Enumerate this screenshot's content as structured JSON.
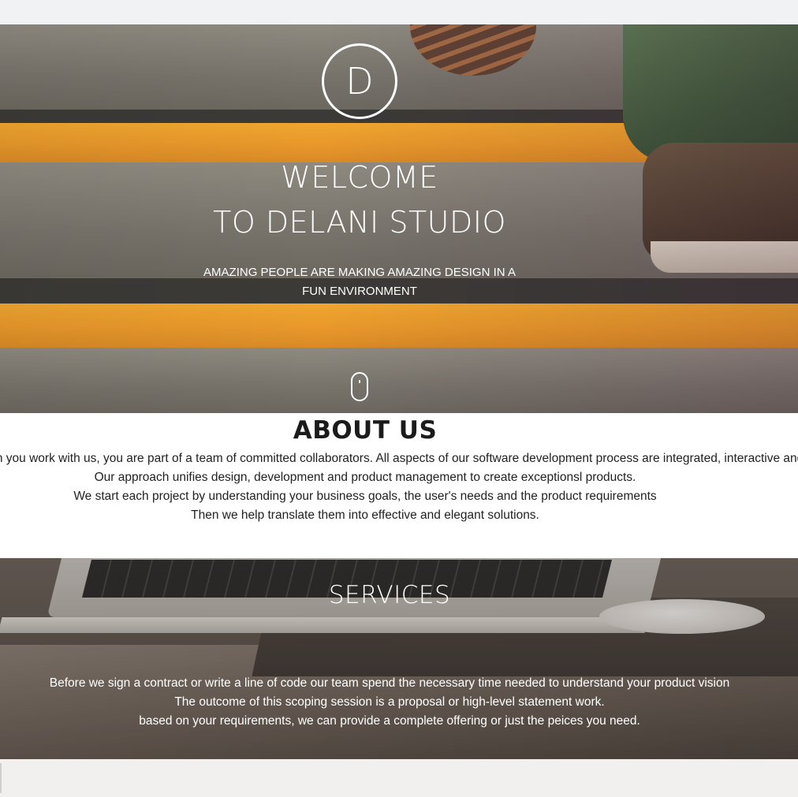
{
  "hero": {
    "logo_letter": "D",
    "title_line1": "WELCOME",
    "title_line2": "TO DELANI STUDIO",
    "subtitle_line1": "AMAZING PEOPLE ARE MAKING AMAZING DESIGN IN A",
    "subtitle_line2": "FUN ENVIRONMENT",
    "scroll_icon": "mouse-scroll-icon"
  },
  "about": {
    "title": "ABOUT US",
    "lines": [
      "When you work with us, you are part of a team of committed collaborators. All aspects of our software development process are integrated, interactive and agile.",
      "Our approach unifies design, development and product management to create exceptionsl products.",
      "We start each project by understanding your business goals, the user's needs and the product requirements",
      "Then we help translate them into effective and elegant solutions."
    ]
  },
  "services": {
    "title": "SERVICES",
    "lines": [
      "Before we sign a contract or write a line of code our team spend the necessary time needed to understand your product vision",
      "The outcome of this scoping session is a proposal or high-level statement work.",
      "based on your requirements, we can provide a complete offering or just the peices you need."
    ]
  },
  "colors": {
    "accent_stripe": "#f0a62f",
    "text_on_image": "#ffffff",
    "about_bg": "#ffffff",
    "page_bg": "#f1f2f3"
  }
}
